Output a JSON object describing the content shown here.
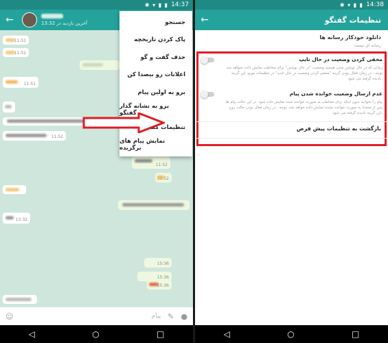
{
  "left": {
    "time": "14:37",
    "chat": {
      "subtitle": "آخرین بازدید در 13:32"
    },
    "menu": [
      "جستجو",
      "پاک کردن تاریخچه",
      "حذف گفت و گو",
      "اعلانات رو بیصدا کن",
      "برو به اولین پیام",
      "برو به نشانه گذار گفتگو",
      "تنظیمات گفتگو",
      "نمایش پیام های برگزیده"
    ],
    "messages": [
      {
        "time": "11:51"
      },
      {
        "time": "11:51"
      },
      {
        "time": "11:51"
      },
      {
        "time": "11:52"
      },
      {
        "time": "11:52"
      },
      {
        "time": "11:52"
      },
      {
        "time": "13:32"
      },
      {
        "time": "15:36"
      },
      {
        "time": "15:36"
      },
      {
        "time": "15:36"
      },
      {
        "time": "13:32"
      }
    ],
    "input_placeholder": "پیام",
    "accent": "#23a39b"
  },
  "right": {
    "time": "14:38",
    "title": "تنظیمات گفتگو",
    "media_title": "دانلود خودکار رسانه ها",
    "media_sub": "رسانه ای نیست",
    "opt1_title": "مخفی کردن وضعیت در حال تایپ",
    "opt1_desc": "زمانی که در حال نوشتن متنی هستید وضعیت \"در حال نوشتن\" برای مخاطب نمایش داده نخواهد شد. توجه : در زمان فعال بودن گزینه \"مخفی کردن وضعیت در حال تایپ\" در تنظیمات موبو، این گزینه نادیده گرفته می شود.",
    "opt2_title": "عدم ارسال وضعیت خوانده شدن پیام",
    "opt2_desc": "پیام را بخوانید بدون اینکه برای مخاطب به صورت خوانده شده نمایش داده شود. در این حالت پیام ها پس از مجددا به صورت خوانده نشده نمایش داده خواهد شد. توجه : در زمان فعال بودن حالت روح این گزینه نادیده گرفته می شود.",
    "reset": "بازگشت به تنظیمات پیش فرض",
    "highlight": "#e01b24"
  }
}
